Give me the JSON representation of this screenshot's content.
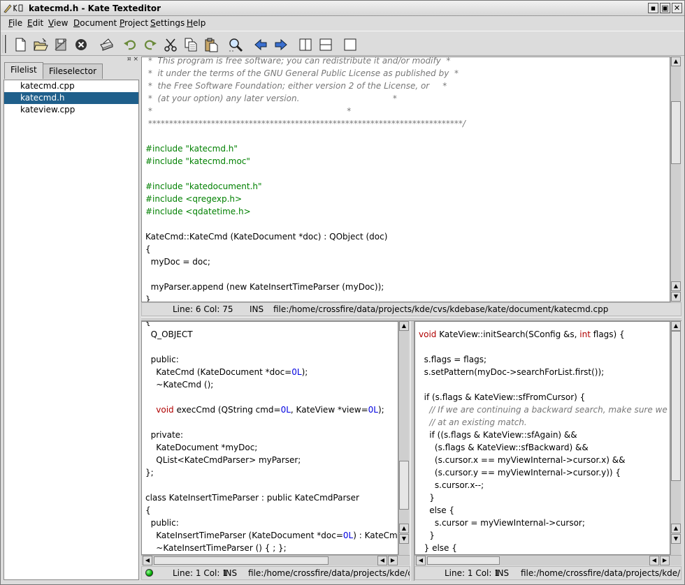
{
  "window": {
    "title": "katecmd.h - Kate Texteditor",
    "title_icon": "kate-icon"
  },
  "menu": {
    "items": [
      "File",
      "Edit",
      "View",
      "Document",
      "Project",
      "Settings",
      "Help"
    ]
  },
  "toolbar": {
    "buttons": [
      "new-file-icon",
      "open-file-icon",
      "save-icon",
      "close-icon",
      "print-icon",
      "undo-icon",
      "redo-icon",
      "cut-icon",
      "copy-icon",
      "paste-icon",
      "find-icon",
      "back-arrow-icon",
      "forward-arrow-icon",
      "split-vertical-icon",
      "split-horizontal-icon",
      "single-view-icon"
    ]
  },
  "sidebar": {
    "tabs": [
      "Filelist",
      "Fileselector"
    ],
    "active_tab": "Filelist",
    "close_glyph": "¤ ×",
    "files": [
      "katecmd.cpp",
      "katecmd.h",
      "kateview.cpp"
    ],
    "selected_file": "katecmd.h"
  },
  "colors": {
    "selection": "#1f5f8b",
    "comment": "#777777",
    "preprocessor": "#008000",
    "keyword": "#b00000",
    "number": "#0000e0"
  },
  "top_pane": {
    "lines": [
      [
        [
          "comment",
          " *  This program is free software; you can redistribute it and/or modify  *"
        ]
      ],
      [
        [
          "comment",
          " *  it under the terms of the GNU General Public License as published by  *"
        ]
      ],
      [
        [
          "comment",
          " *  the Free Software Foundation; either version 2 of the License, or     *"
        ]
      ],
      [
        [
          "comment",
          " *  (at your option) any later version.                                   *"
        ]
      ],
      [
        [
          "comment",
          " *                                                                         *"
        ]
      ],
      [
        [
          "comment",
          " ***************************************************************************/"
        ]
      ],
      [
        [
          "plain",
          ""
        ]
      ],
      [
        [
          "prep",
          "#include \"katecmd.h\""
        ]
      ],
      [
        [
          "prep",
          "#include \"katecmd.moc\""
        ]
      ],
      [
        [
          "plain",
          ""
        ]
      ],
      [
        [
          "prep",
          "#include \"katedocument.h\""
        ]
      ],
      [
        [
          "prep",
          "#include <qregexp.h>"
        ]
      ],
      [
        [
          "prep",
          "#include <qdatetime.h>"
        ]
      ],
      [
        [
          "plain",
          ""
        ]
      ],
      [
        [
          "plain",
          "KateCmd::KateCmd (KateDocument *doc) : QObject (doc)"
        ]
      ],
      [
        [
          "plain",
          "{"
        ]
      ],
      [
        [
          "plain",
          "  myDoc = doc;"
        ]
      ],
      [
        [
          "plain",
          ""
        ]
      ],
      [
        [
          "plain",
          "  myParser.append (new KateInsertTimeParser (myDoc));"
        ]
      ],
      [
        [
          "plain",
          "}"
        ]
      ]
    ],
    "status": {
      "position": "Line: 6 Col: 75",
      "mode": "INS",
      "path": "file:/home/crossfire/data/projects/kde/cvs/kdebase/kate/document/katecmd.cpp"
    }
  },
  "bottom_left_pane": {
    "lines": [
      [
        [
          "plain",
          "{"
        ]
      ],
      [
        [
          "plain",
          "  Q_OBJECT"
        ]
      ],
      [
        [
          "plain",
          ""
        ]
      ],
      [
        [
          "plain",
          "  public:"
        ]
      ],
      [
        [
          "plain",
          "    KateCmd (KateDocument *doc="
        ],
        [
          "num",
          "0L"
        ],
        [
          "plain",
          ");"
        ]
      ],
      [
        [
          "plain",
          "    ~KateCmd ();"
        ]
      ],
      [
        [
          "plain",
          ""
        ]
      ],
      [
        [
          "plain",
          "    "
        ],
        [
          "kw",
          "void"
        ],
        [
          "plain",
          " execCmd (QString cmd="
        ],
        [
          "num",
          "0L"
        ],
        [
          "plain",
          ", KateView *view="
        ],
        [
          "num",
          "0L"
        ],
        [
          "plain",
          ");"
        ]
      ],
      [
        [
          "plain",
          ""
        ]
      ],
      [
        [
          "plain",
          "  private:"
        ]
      ],
      [
        [
          "plain",
          "    KateDocument *myDoc;"
        ]
      ],
      [
        [
          "plain",
          "    QList<KateCmdParser> myParser;"
        ]
      ],
      [
        [
          "plain",
          "};"
        ]
      ],
      [
        [
          "plain",
          ""
        ]
      ],
      [
        [
          "plain",
          "class KateInsertTimeParser : public KateCmdParser"
        ]
      ],
      [
        [
          "plain",
          "{"
        ]
      ],
      [
        [
          "plain",
          "  public:"
        ]
      ],
      [
        [
          "plain",
          "    KateInsertTimeParser (KateDocument *doc="
        ],
        [
          "num",
          "0L"
        ],
        [
          "plain",
          ") : KateCmdParser (doc) { ; };"
        ]
      ],
      [
        [
          "plain",
          "    ~KateInsertTimeParser () { ; };"
        ]
      ]
    ],
    "status": {
      "position": "Line: 1 Col: 1",
      "mode": "INS",
      "path": "file:/home/crossfire/data/projects/kde/cvs/kdebase/kate/document/katecmd.h"
    }
  },
  "bottom_right_pane": {
    "lines": [
      [
        [
          "kw",
          "void"
        ],
        [
          "plain",
          " KateView::initSearch(SConfig &s, "
        ],
        [
          "kw",
          "int"
        ],
        [
          "plain",
          " flags) {"
        ]
      ],
      [
        [
          "plain",
          ""
        ]
      ],
      [
        [
          "plain",
          "  s.flags = flags;"
        ]
      ],
      [
        [
          "plain",
          "  s.setPattern(myDoc->searchForList.first());"
        ]
      ],
      [
        [
          "plain",
          ""
        ]
      ],
      [
        [
          "plain",
          "  if (s.flags & KateView::sfFromCursor) {"
        ]
      ],
      [
        [
          "comment",
          "    // If we are continuing a backward search, make sure we do not get stuck"
        ]
      ],
      [
        [
          "comment",
          "    // at an existing match."
        ]
      ],
      [
        [
          "plain",
          "    if ((s.flags & KateView::sfAgain) &&"
        ]
      ],
      [
        [
          "plain",
          "      (s.flags & KateView::sfBackward) &&"
        ]
      ],
      [
        [
          "plain",
          "      (s.cursor.x == myViewInternal->cursor.x) &&"
        ]
      ],
      [
        [
          "plain",
          "      (s.cursor.y == myViewInternal->cursor.y)) {"
        ]
      ],
      [
        [
          "plain",
          "      s.cursor.x--;"
        ]
      ],
      [
        [
          "plain",
          "    }"
        ]
      ],
      [
        [
          "plain",
          "    else {"
        ]
      ],
      [
        [
          "plain",
          "      s.cursor = myViewInternal->cursor;"
        ]
      ],
      [
        [
          "plain",
          "    }"
        ]
      ],
      [
        [
          "plain",
          "  } else {"
        ]
      ]
    ],
    "status": {
      "position": "Line: 1 Col: 1",
      "mode": "INS",
      "path": "file:/home/crossfire/data/projects/kde/cvs/kdebase/kate/view/kateview.cpp"
    }
  }
}
